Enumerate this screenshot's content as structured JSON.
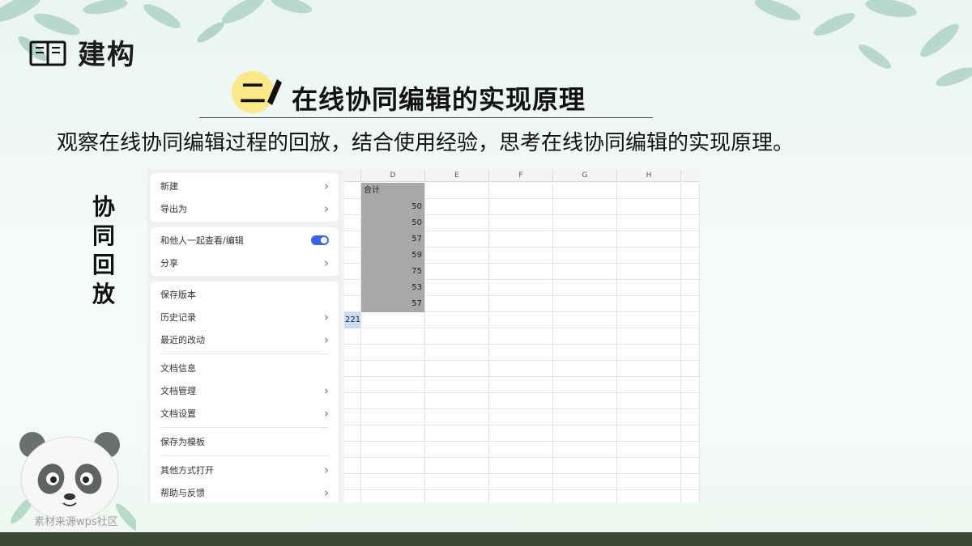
{
  "header": {
    "icon": "book-icon",
    "title": "建构"
  },
  "section": {
    "number": "二",
    "title": "在线协同编辑的实现原理"
  },
  "intro_text": "观察在线协同编辑过程的回放，结合使用经验，思考在线协同编辑的实现原理。",
  "side_label": [
    "协",
    "同",
    "回",
    "放"
  ],
  "menu": {
    "group1": [
      {
        "label": "新建"
      },
      {
        "label": "导出为"
      }
    ],
    "group2": [
      {
        "label": "和他人一起查看/编辑"
      },
      {
        "label": "分享"
      }
    ],
    "group3": [
      {
        "label": "保存版本"
      },
      {
        "label": "历史记录"
      },
      {
        "label": "最近的改动"
      },
      {
        "label": "文档信息"
      },
      {
        "label": "文档管理"
      },
      {
        "label": "文档设置"
      },
      {
        "label": "保存为模板"
      },
      {
        "label": "其他方式打开"
      },
      {
        "label": "帮助与反馈"
      }
    ]
  },
  "sheet": {
    "columns": [
      "D",
      "E",
      "F",
      "G",
      "H"
    ],
    "header_cell": "合计",
    "values": [
      "50",
      "50",
      "57",
      "59",
      "75",
      "53",
      "57"
    ],
    "selected_cell": "221"
  },
  "credit": "素材来源wps社区",
  "colors": {
    "accent_yellow": "#fbe88a",
    "toggle_blue": "#3a64e8",
    "footer": "#3a4a36"
  }
}
